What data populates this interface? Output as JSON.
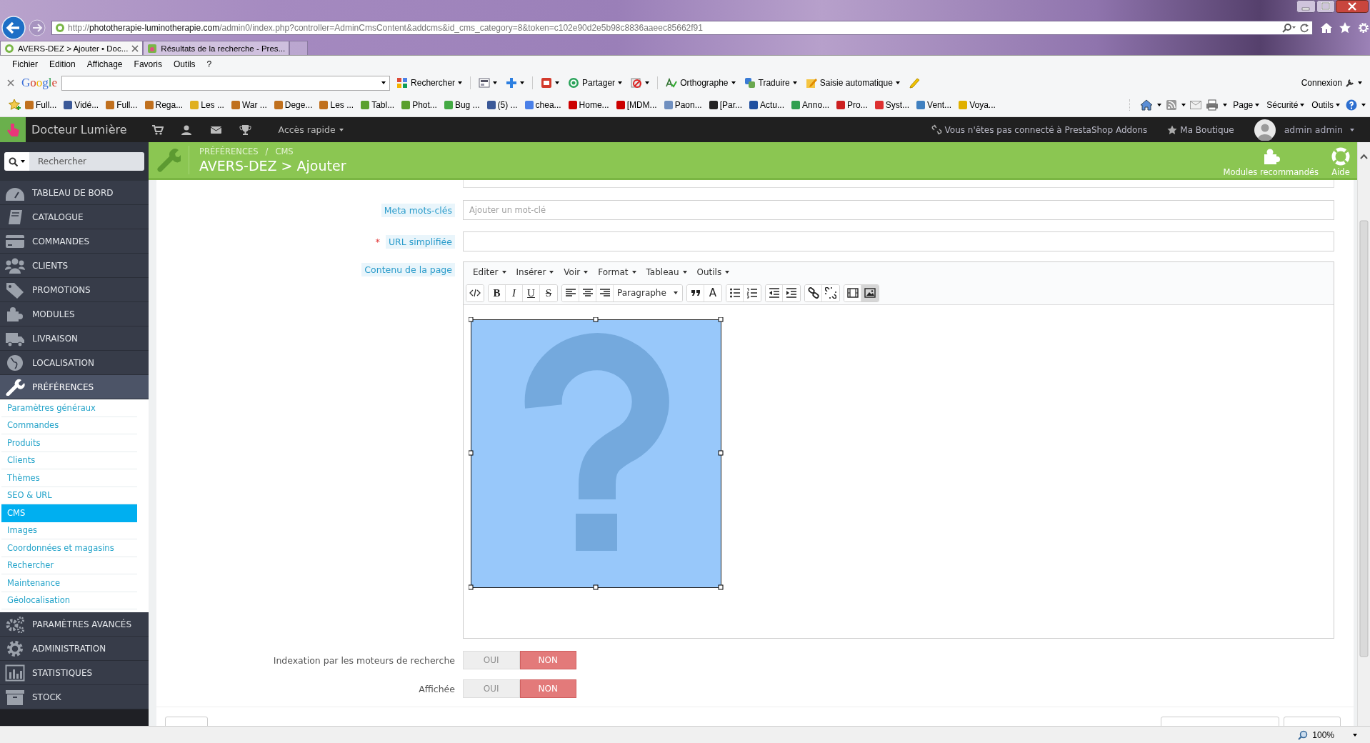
{
  "browser": {
    "address": {
      "scheme": "http://",
      "domain": "phototherapie-luminotherapie.com",
      "path": "/admin0/index.php?controller=AdminCmsContent&addcms&id_cms_category=8&token=c102e90d2e5b98c8836aaeec85662f91"
    },
    "tabs": [
      {
        "label": "AVERS-DEZ > Ajouter • Doc...",
        "selected": true
      },
      {
        "label": "Résultats de la recherche - Pres...",
        "selected": false
      }
    ],
    "menu": [
      "Fichier",
      "Edition",
      "Affichage",
      "Favoris",
      "Outils",
      "?"
    ],
    "google_toolbar": {
      "logo": "Google",
      "items": [
        {
          "kind": "grid",
          "label": "Rechercher"
        },
        {
          "kind": "page"
        },
        {
          "kind": "plus"
        },
        {
          "kind": "gplus"
        },
        {
          "kind": "share",
          "label": "Partager"
        },
        {
          "kind": "block"
        },
        {
          "kind": "spell",
          "label": "Orthographe"
        },
        {
          "kind": "translate",
          "label": "Traduire"
        },
        {
          "kind": "autofill",
          "label": "Saisie automatique"
        },
        {
          "kind": "pencil"
        }
      ],
      "connexion": "Connexion"
    },
    "favorites": [
      {
        "label": "Full...",
        "color": "#c0701e"
      },
      {
        "label": "Vidé...",
        "color": "#3b5998"
      },
      {
        "label": "Full...",
        "color": "#c0701e"
      },
      {
        "label": "Rega...",
        "color": "#c0701e"
      },
      {
        "label": "Les ...",
        "color": "#e0b020"
      },
      {
        "label": "War ...",
        "color": "#c0701e"
      },
      {
        "label": "Dege...",
        "color": "#c0701e"
      },
      {
        "label": "Les ...",
        "color": "#c0701e"
      },
      {
        "label": "Tabl...",
        "color": "#5aa02c"
      },
      {
        "label": "Phot...",
        "color": "#5aa02c"
      },
      {
        "label": "Bug ...",
        "color": "#44aa44"
      },
      {
        "label": "(5) ...",
        "color": "#3b5998"
      },
      {
        "label": "chea...",
        "color": "#4a80e8"
      },
      {
        "label": "Home...",
        "color": "#cc0000"
      },
      {
        "label": "[MDM...",
        "color": "#cc0000"
      },
      {
        "label": "Paon...",
        "color": "#7090c0"
      },
      {
        "label": "[Par...",
        "color": "#222222"
      },
      {
        "label": "Actu...",
        "color": "#2050a0"
      },
      {
        "label": "Anno...",
        "color": "#30a050"
      },
      {
        "label": "Pro...",
        "color": "#cc2020"
      },
      {
        "label": "Syst...",
        "color": "#dd3030"
      },
      {
        "label": "Vent...",
        "color": "#4080c0"
      },
      {
        "label": "Voya...",
        "color": "#e0b000"
      }
    ],
    "command_bar": [
      "Page",
      "Sécurité",
      "Outils"
    ]
  },
  "topbar": {
    "shop_name": "Docteur Lumière",
    "quick_access": "Accès rapide",
    "addons_notice": "Vous n'êtes pas connecté à PrestaShop Addons",
    "shop_link": "Ma Boutique",
    "user": "admin admin"
  },
  "sidebar": {
    "search_placeholder": "Rechercher",
    "items": [
      {
        "label": "TABLEAU DE BORD",
        "selected": false
      },
      {
        "label": "CATALOGUE",
        "selected": false
      },
      {
        "label": "COMMANDES",
        "selected": false
      },
      {
        "label": "CLIENTS",
        "selected": false
      },
      {
        "label": "PROMOTIONS",
        "selected": false
      },
      {
        "label": "MODULES",
        "selected": false
      },
      {
        "label": "LIVRAISON",
        "selected": false
      },
      {
        "label": "LOCALISATION",
        "selected": false
      },
      {
        "label": "PRÉFÉRENCES",
        "selected": true,
        "children": [
          {
            "label": "Paramètres généraux",
            "selected": false
          },
          {
            "label": "Commandes",
            "selected": false
          },
          {
            "label": "Produits",
            "selected": false
          },
          {
            "label": "Clients",
            "selected": false
          },
          {
            "label": "Thèmes",
            "selected": false
          },
          {
            "label": "SEO & URL",
            "selected": false
          },
          {
            "label": "CMS",
            "selected": true
          },
          {
            "label": "Images",
            "selected": false
          },
          {
            "label": "Coordonnées et magasins",
            "selected": false
          },
          {
            "label": "Rechercher",
            "selected": false
          },
          {
            "label": "Maintenance",
            "selected": false
          },
          {
            "label": "Géolocalisation",
            "selected": false
          }
        ]
      },
      {
        "label": "PARAMÈTRES AVANCÉS",
        "selected": false
      },
      {
        "label": "ADMINISTRATION",
        "selected": false
      },
      {
        "label": "STATISTIQUES",
        "selected": false
      },
      {
        "label": "STOCK",
        "selected": false
      }
    ]
  },
  "header": {
    "breadcrumb": [
      "PRÉFÉRENCES",
      "/",
      "CMS"
    ],
    "title": "AVERS-DEZ > Ajouter",
    "actions": [
      {
        "kind": "modules",
        "label": "Modules recommandés"
      },
      {
        "kind": "help",
        "label": "Aide"
      }
    ]
  },
  "form": {
    "fields": [
      {
        "label": "Meta mots-clés",
        "placeholder": "Ajouter un mot-clé"
      },
      {
        "label": "URL simplifiée",
        "required_mark": "*"
      }
    ],
    "editor": {
      "label": "Contenu de la page",
      "menus": [
        "Editer",
        "Insérer",
        "Voir",
        "Format",
        "Tableau",
        "Outils"
      ],
      "toolbar": [
        [
          {
            "kind": "code",
            "active": false
          }
        ],
        [
          {
            "kind": "bold",
            "glyph": "B",
            "active": false
          },
          {
            "kind": "italic",
            "glyph": "I",
            "active": false
          },
          {
            "kind": "underline",
            "glyph": "U",
            "active": false
          },
          {
            "kind": "strike",
            "glyph": "S",
            "active": false
          }
        ],
        [
          {
            "kind": "align-left",
            "active": false
          },
          {
            "kind": "align-center",
            "active": false
          },
          {
            "kind": "align-right",
            "active": false
          },
          {
            "kind": "select",
            "value": "Paragraphe",
            "active": false
          }
        ],
        [
          {
            "kind": "quote",
            "active": false
          },
          {
            "kind": "text-color",
            "glyph": "A",
            "active": false
          }
        ],
        [
          {
            "kind": "bullets",
            "active": false
          },
          {
            "kind": "numbers",
            "active": false
          }
        ],
        [
          {
            "kind": "outdent",
            "active": false
          },
          {
            "kind": "indent",
            "active": false
          }
        ],
        [
          {
            "kind": "link",
            "active": false
          },
          {
            "kind": "unlink",
            "active": false
          }
        ],
        [
          {
            "kind": "media",
            "active": false
          },
          {
            "kind": "image",
            "active": true
          }
        ]
      ]
    },
    "toggles": [
      {
        "label": "Indexation par les moteurs de recherche",
        "options": [
          {
            "label": "OUI",
            "selected": false
          },
          {
            "label": "NON",
            "selected": true
          }
        ]
      },
      {
        "label": "Affichée",
        "options": [
          {
            "label": "OUI",
            "selected": false
          },
          {
            "label": "NON",
            "selected": true
          }
        ]
      }
    ]
  },
  "status_bar": {
    "zoom": "100%"
  }
}
